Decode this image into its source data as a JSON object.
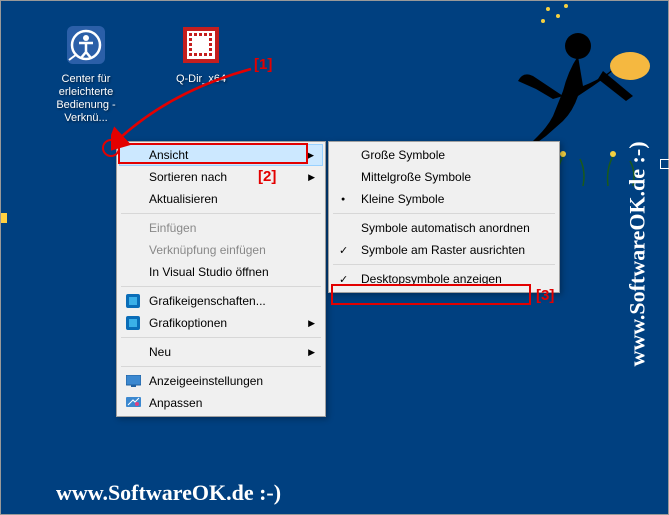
{
  "desktop": {
    "icons": [
      {
        "label": "Center für erleichterte Bedienung - Verknü..."
      },
      {
        "label": "Q-Dir_x64"
      }
    ]
  },
  "contextMenu": {
    "items": [
      {
        "label": "Ansicht",
        "hasSubmenu": true,
        "highlighted": true
      },
      {
        "label": "Sortieren nach",
        "hasSubmenu": true
      },
      {
        "label": "Aktualisieren"
      },
      {
        "sep": true
      },
      {
        "label": "Einfügen",
        "disabled": true
      },
      {
        "label": "Verknüpfung einfügen",
        "disabled": true
      },
      {
        "label": "In Visual Studio öffnen"
      },
      {
        "sep": true
      },
      {
        "label": "Grafikeigenschaften...",
        "icon": "intel"
      },
      {
        "label": "Grafikoptionen",
        "icon": "intel",
        "hasSubmenu": true
      },
      {
        "sep": true
      },
      {
        "label": "Neu",
        "hasSubmenu": true
      },
      {
        "sep": true
      },
      {
        "label": "Anzeigeeinstellungen",
        "icon": "display"
      },
      {
        "label": "Anpassen",
        "icon": "personalize"
      }
    ]
  },
  "submenu": {
    "items": [
      {
        "label": "Große Symbole"
      },
      {
        "label": "Mittelgroße Symbole"
      },
      {
        "label": "Kleine Symbole",
        "bullet": true
      },
      {
        "sep": true
      },
      {
        "label": "Symbole automatisch anordnen"
      },
      {
        "label": "Symbole am Raster ausrichten",
        "check": true
      },
      {
        "sep": true
      },
      {
        "label": "Desktopsymbole anzeigen",
        "check": true,
        "highlighted": true
      }
    ]
  },
  "annotations": {
    "a1": "[1]",
    "a2": "[2]",
    "a3": "[3]"
  },
  "watermark": "www.SoftwareOK.de :-)"
}
